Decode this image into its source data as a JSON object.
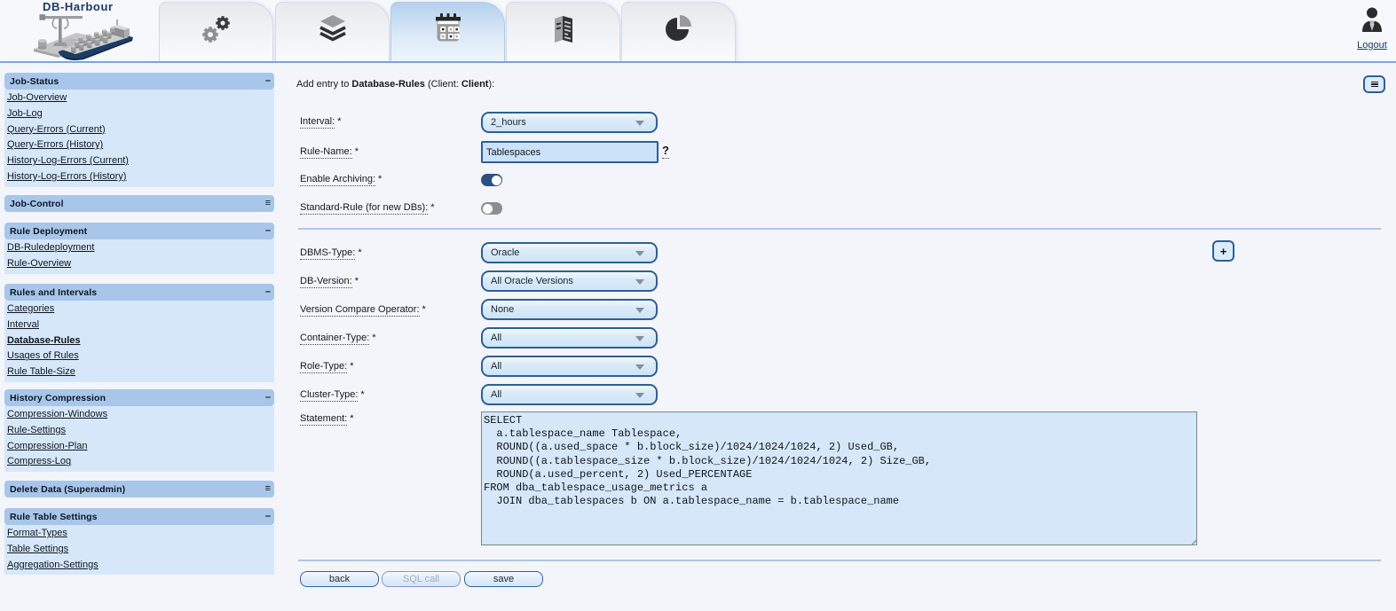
{
  "header": {
    "logo_text": "DB-Harbour",
    "tabs": [
      {
        "icon": "gears-icon",
        "selected": false
      },
      {
        "icon": "layers-icon",
        "selected": false
      },
      {
        "icon": "calendar-icon",
        "selected": true
      },
      {
        "icon": "report-icon",
        "selected": false
      },
      {
        "icon": "pie-chart-icon",
        "selected": false
      }
    ],
    "logout_label": "Logout",
    "logout_icon": "user-icon",
    "logo_icon": "harbour-ship-icon"
  },
  "sidebar": {
    "sections": [
      {
        "title": "Job-Status",
        "state": "expanded",
        "toggle_glyph": "–",
        "items": [
          "Job-Overview",
          "Job-Log",
          "Query-Errors (Current)",
          "Query-Errors (History)",
          "History-Log-Errors (Current)",
          "History-Log-Errors (History)"
        ]
      },
      {
        "title": "Job-Control",
        "state": "collapsed",
        "toggle_glyph": "≡",
        "items": []
      },
      {
        "title": "Rule Deployment",
        "state": "expanded",
        "toggle_glyph": "–",
        "items": [
          "DB-Ruledeployment",
          "Rule-Overview"
        ]
      },
      {
        "title": "Rules and Intervals",
        "state": "expanded",
        "toggle_glyph": "–",
        "items": [
          "Categories",
          "Interval",
          "Database-Rules",
          "Usages of Rules",
          "Rule Table-Size"
        ],
        "active_item": "Database-Rules"
      },
      {
        "title": "History Compression",
        "state": "expanded",
        "toggle_glyph": "–",
        "items": [
          "Compression-Windows",
          "Rule-Settings",
          "Compression-Plan",
          "Compress-Log"
        ]
      },
      {
        "title": "Delete Data (Superadmin)",
        "state": "collapsed",
        "toggle_glyph": "≡",
        "items": []
      },
      {
        "title": "Rule Table Settings",
        "state": "expanded",
        "toggle_glyph": "–",
        "items": [
          "Format-Types",
          "Table Settings",
          "Aggregation-Settings"
        ]
      }
    ]
  },
  "main": {
    "title": {
      "part1": "Add entry to ",
      "entity": "Database-Rules",
      "part2": " (Client: ",
      "client": "Client",
      "part3": "):"
    },
    "menu_button_icon": "hamburger-icon",
    "add_button_label": "+",
    "form": {
      "interval": {
        "label": "Interval:",
        "required": "*",
        "value": "2_hours"
      },
      "rule_name": {
        "label": "Rule-Name:",
        "required": "*",
        "value": "Tablespaces",
        "help": "?"
      },
      "enable_archiving": {
        "label": "Enable Archiving:",
        "required": "*",
        "value": "on"
      },
      "standard_rule": {
        "label": "Standard-Rule (for new DBs):",
        "required": "*",
        "value": "off"
      },
      "dbms_type": {
        "label": "DBMS-Type:",
        "required": "*",
        "value": "Oracle"
      },
      "db_version": {
        "label": "DB-Version:",
        "required": "*",
        "value": "All Oracle Versions"
      },
      "version_compare_operator": {
        "label": "Version Compare Operator:",
        "required": "*",
        "value": "None"
      },
      "container_type": {
        "label": "Container-Type:",
        "required": "*",
        "value": "All"
      },
      "role_type": {
        "label": "Role-Type:",
        "required": "*",
        "value": "All"
      },
      "cluster_type": {
        "label": "Cluster-Type:",
        "required": "*",
        "value": "All"
      },
      "statement": {
        "label": "Statement:",
        "required": "*",
        "value": "SELECT\n  a.tablespace_name Tablespace,\n  ROUND((a.used_space * b.block_size)/1024/1024/1024, 2) Used_GB,\n  ROUND((a.tablespace_size * b.block_size)/1024/1024/1024, 2) Size_GB,\n  ROUND(a.used_percent, 2) Used_PERCENTAGE\nFROM dba_tablespace_usage_metrics a\n  JOIN dba_tablespaces b ON a.tablespace_name = b.tablespace_name"
      }
    },
    "buttons": [
      {
        "label": "back",
        "disabled": false
      },
      {
        "label": "SQL call",
        "disabled": true
      },
      {
        "label": "save",
        "disabled": false
      }
    ]
  },
  "colors": {
    "accent_border": "#2d5f97",
    "panel_header_bg": "#a8c6e9",
    "panel_body_bg": "#d7e7fa",
    "toggle_on": "#2b5180",
    "toggle_off": "#8d8d8d",
    "header_divider": "#7ba6d8"
  }
}
